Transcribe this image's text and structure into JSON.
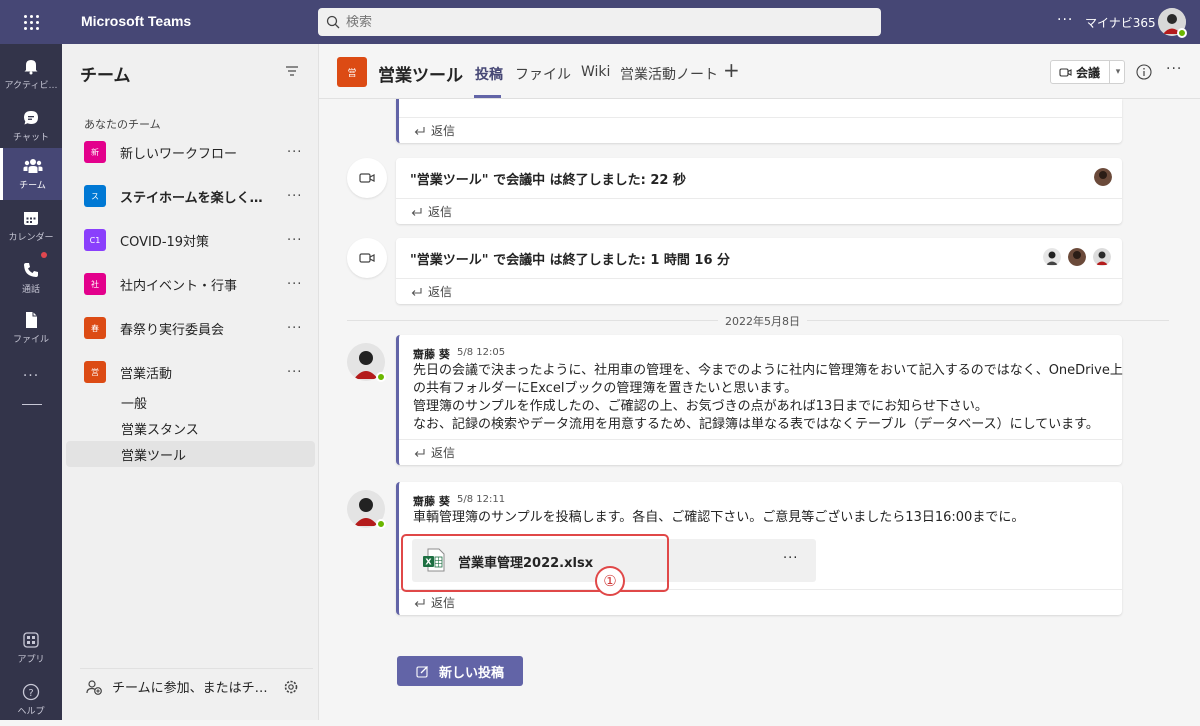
{
  "app": {
    "name": "Microsoft Teams",
    "org": "マイナビ365",
    "more": "···"
  },
  "search": {
    "placeholder": "検索"
  },
  "rail": {
    "items": [
      {
        "label": "アクティビ…",
        "icon": "bell-icon"
      },
      {
        "label": "チャット",
        "icon": "chat-icon"
      },
      {
        "label": "チーム",
        "icon": "teams-icon",
        "active": true
      },
      {
        "label": "カレンダー",
        "icon": "calendar-icon"
      },
      {
        "label": "通話",
        "icon": "phone-icon"
      },
      {
        "label": "ファイル",
        "icon": "file-icon"
      },
      {
        "label": "アプリ",
        "icon": "apps-icon"
      },
      {
        "label": "ヘルプ",
        "icon": "help-icon"
      }
    ],
    "more": "···",
    "colors": {
      "rail": "#33344a",
      "topbar": "#464775",
      "accent": "#6264a7"
    }
  },
  "panel": {
    "title": "チーム",
    "section": "あなたのチーム",
    "more": "···",
    "teams": [
      {
        "name": "新しいワークフロー",
        "tile": "新",
        "color": "#e3008c"
      },
      {
        "name": "ステイホームを楽しく…",
        "tile": "ス",
        "color": "#0078d4",
        "bold": true
      },
      {
        "name": "COVID-19対策",
        "tile": "C1",
        "color": "#8a3ffc"
      },
      {
        "name": "社内イベント・行事",
        "tile": "社",
        "color": "#e3008c"
      },
      {
        "name": "春祭り実行委員会",
        "tile": "春",
        "color": "#dc4b14"
      },
      {
        "name": "営業活動",
        "tile": "営",
        "color": "#dc4b14"
      }
    ],
    "channels": [
      "一般",
      "営業スタンス",
      "営業ツール"
    ],
    "join_label": "チームに参加、またはチ…"
  },
  "header": {
    "tile": "営",
    "title": "営業ツール",
    "tabs": [
      "投稿",
      "ファイル",
      "Wiki",
      "営業活動ノート"
    ],
    "add": "+",
    "meet_label": "会議",
    "more": "···"
  },
  "feed": {
    "reply_label": "返信",
    "meetings": [
      {
        "text": "\"営業ツール\" で会議中 は終了しました: 22 秒"
      },
      {
        "text": "\"営業ツール\" で会議中 は終了しました: 1 時間 16 分"
      }
    ],
    "date_divider": "2022年5月8日",
    "posts": [
      {
        "author": "齋藤 葵",
        "time": "5/8 12:05",
        "lines": [
          "先日の会議で決まったように、社用車の管理を、今までのように社内に管理簿をおいて記入するのではなく、OneDrive上",
          "の共有フォルダーにExcelブックの管理簿を置きたいと思います。",
          "管理簿のサンプルを作成したの、ご確認の上、お気づきの点があれば13日までにお知らせ下さい。",
          "なお、記録の検索やデータ流用を用意するため、記録簿は単なる表ではなくテーブル（データベース）にしています。"
        ]
      },
      {
        "author": "齋藤 葵",
        "time": "5/8 12:11",
        "lines": [
          "車輌管理簿のサンプルを投稿します。各自、ご確認下さい。ご意見等ございましたら13日16:00までに。"
        ],
        "file": {
          "name": "営業車管理2022.xlsx",
          "more": "···"
        }
      }
    ],
    "callout": "①",
    "new_post_label": "新しい投稿"
  }
}
